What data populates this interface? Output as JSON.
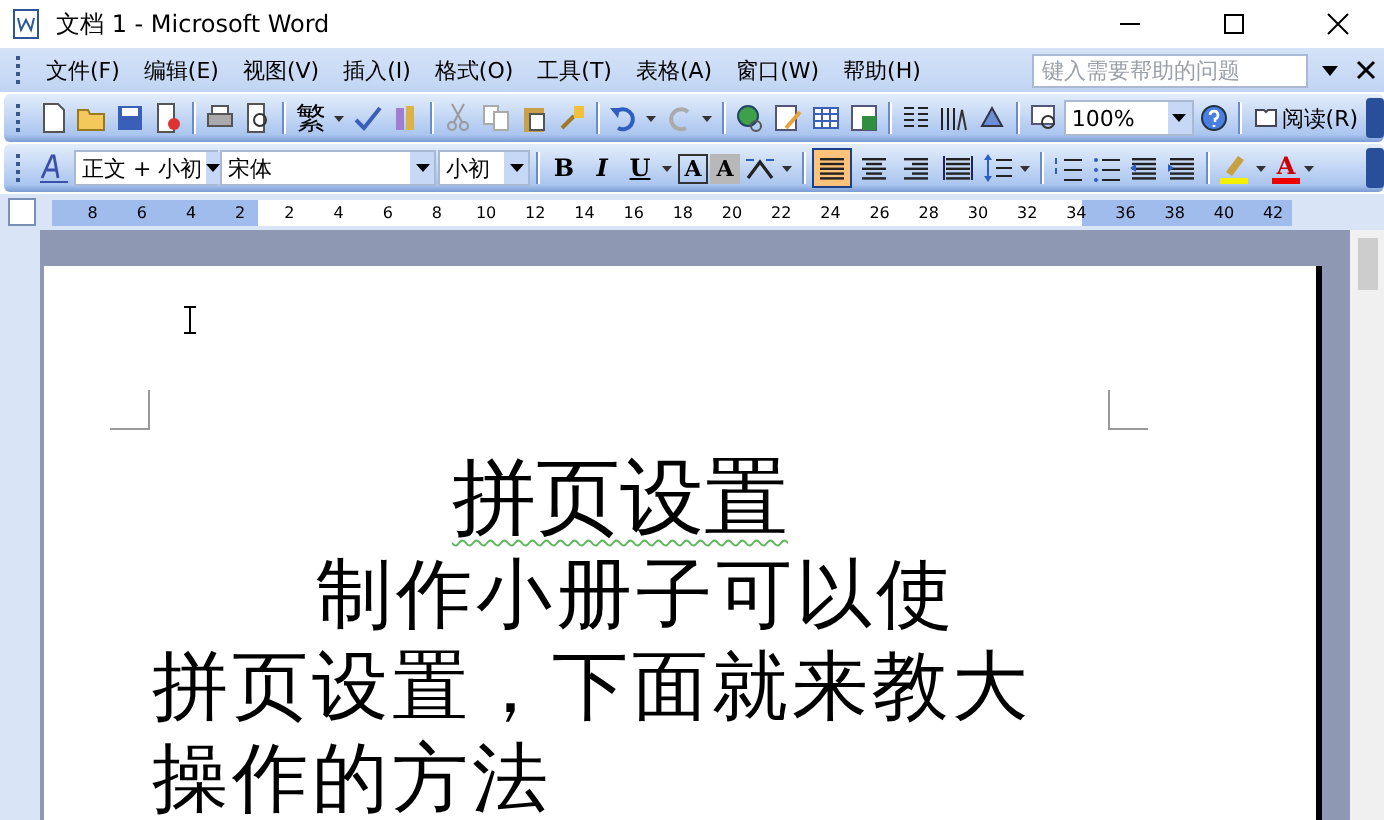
{
  "window": {
    "title": "文档 1 - Microsoft Word"
  },
  "menu": [
    "文件(F)",
    "编辑(E)",
    "视图(V)",
    "插入(I)",
    "格式(O)",
    "工具(T)",
    "表格(A)",
    "窗口(W)",
    "帮助(H)"
  ],
  "help_search": {
    "placeholder": "键入需要帮助的问题"
  },
  "standard_toolbar": {
    "traditional": "繁",
    "zoom": "100%",
    "read_button": "阅读(R)"
  },
  "formatting_toolbar": {
    "style": "正文 + 小初",
    "font": "宋体",
    "size": "小初",
    "bold": "B",
    "italic": "I",
    "underline": "U",
    "char_border": "A",
    "char_shading": "A",
    "font_color": "A",
    "alignments": [
      {
        "selected": true
      },
      {
        "selected": false
      },
      {
        "selected": false
      },
      {
        "selected": false
      }
    ]
  },
  "ruler": {
    "ticks": [
      "8",
      "6",
      "4",
      "2",
      "2",
      "4",
      "6",
      "8",
      "10",
      "12",
      "14",
      "16",
      "18",
      "20",
      "22",
      "24",
      "26",
      "28",
      "30",
      "32",
      "34",
      "36",
      "38",
      "40",
      "42"
    ]
  },
  "document": {
    "title": "拼页设置",
    "paragraph_lines": [
      "制作小册子可以使",
      "拼页设置，下面就来教大",
      "操作的方法"
    ]
  }
}
